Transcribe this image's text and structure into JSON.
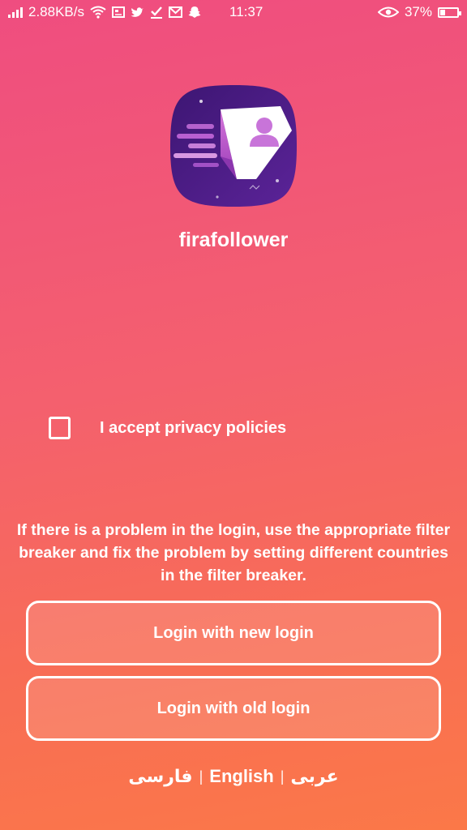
{
  "status_bar": {
    "network_speed": "2.88KB/s",
    "time": "11:37",
    "battery_percent": "37%",
    "icons_left": [
      "signal-icon",
      "wifi-icon",
      "news-icon",
      "twitter-icon",
      "check-icon",
      "mail-icon",
      "snapchat-icon"
    ],
    "icons_right": [
      "eye-icon",
      "battery-icon"
    ]
  },
  "app": {
    "name": "firafollower",
    "logo_colors": {
      "background": "#4a1a86",
      "accent": "#c56ad8",
      "panel": "#ffffff"
    }
  },
  "privacy": {
    "label": "I accept privacy policies",
    "checked": false
  },
  "notice": "If there is a problem in the login, use the appropriate filter breaker and fix the problem by setting different countries in the filter breaker.",
  "buttons": {
    "new_login": "Login with new login",
    "old_login": "Login with old login"
  },
  "languages": {
    "persian": "فارسی",
    "separator": "|",
    "english": "English",
    "arabic": "عربی"
  },
  "colors": {
    "gradient_top": "#ef4d80",
    "gradient_bottom": "#fb7848"
  }
}
